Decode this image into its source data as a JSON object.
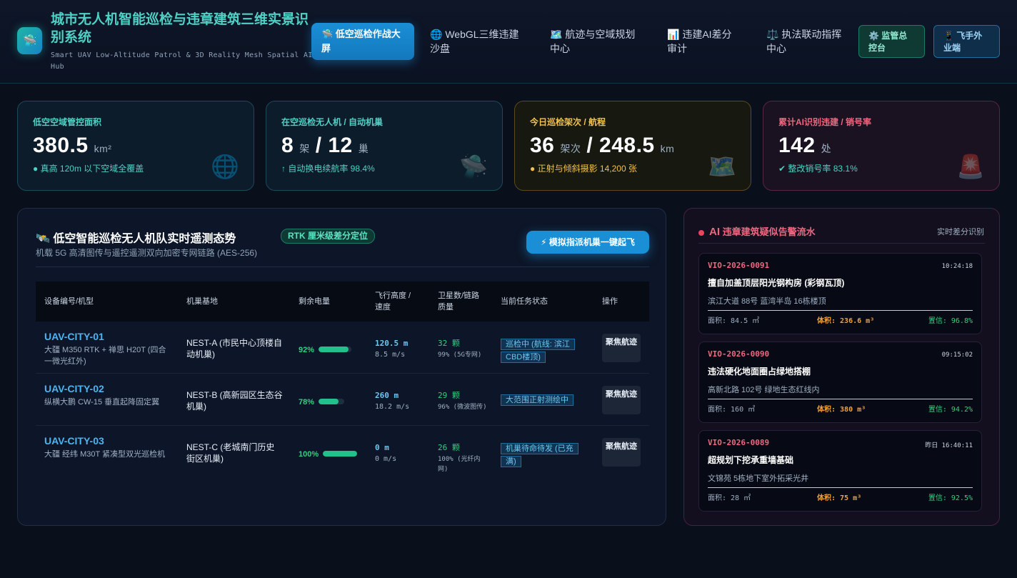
{
  "header": {
    "title": "城市无人机智能巡检与违章建筑三维实景识别系统",
    "subtitle": "Smart UAV Low-Altitude Patrol & 3D Reality Mesh Spatial AI Hub",
    "logo_icon": "ufo-icon",
    "nav": [
      {
        "label": "🛸 低空巡检作战大屏",
        "active": true
      },
      {
        "label": "🌐 WebGL三维违建沙盘",
        "active": false
      },
      {
        "label": "🗺️ 航迹与空域规划中心",
        "active": false
      },
      {
        "label": "📊 违建AI差分审计",
        "active": false
      },
      {
        "label": "⚖️ 执法联动指挥中心",
        "active": false
      }
    ],
    "supervise_label": "⚙️ 监管总控台",
    "mobile_label": "📱 飞手外业端"
  },
  "stats": [
    {
      "label": "低空空域管控面积",
      "value": "380.5",
      "unit": "km²",
      "sub": "● 真高 120m 以下空域全覆盖",
      "icon": "globe-icon"
    },
    {
      "label": "在空巡检无人机 / 自动机巢",
      "value_a": "8",
      "unit_a": "架",
      "value_b": "/ 12",
      "unit_b": "巢",
      "sub": "↑ 自动换电续航率 98.4%",
      "icon": "ufo-icon"
    },
    {
      "label": "今日巡检架次 / 航程",
      "value_a": "36",
      "unit_a": "架次",
      "value_b": "/ 248.5",
      "unit_b": "km",
      "sub": "● 正射与倾斜摄影 14,200 张",
      "icon": "map-icon"
    },
    {
      "label": "累计AI识别违建 / 销号率",
      "value": "142",
      "unit": "处",
      "sub": "✔ 整改销号率 83.1%",
      "icon": "siren-icon"
    }
  ],
  "fleet": {
    "title": "🛰️ 低空智能巡检无人机队实时遥测态势",
    "badge": "RTK 厘米级差分定位",
    "desc": "机载 5G 高清图传与遥控遥测双向加密专网链路 (AES-256)",
    "dispatch_label": "⚡ 模拟指派机巢一键起飞",
    "columns": [
      "设备编号/机型",
      "机巢基地",
      "剩余电量",
      "飞行高度 / 速度",
      "卫星数/链路质量",
      "当前任务状态",
      "操作"
    ],
    "rows": [
      {
        "id": "UAV-CITY-01",
        "model": "大疆 M350 RTK + 禅思 H20T (四合一微光红外)",
        "nest": "NEST-A (市民中心顶楼自动机巢)",
        "battery": "92%",
        "battery_level": 0.92,
        "altitude": "120.5 m",
        "speed": "8.5 m/s",
        "sats": "32 颗",
        "link": "99% (5G专网)",
        "status": "巡检中 (航线: 滨江CBD楼顶)",
        "action": "聚焦航迹"
      },
      {
        "id": "UAV-CITY-02",
        "model": "纵横大鹏 CW-15 垂直起降固定翼",
        "nest": "NEST-B (高新园区生态谷机巢)",
        "battery": "78%",
        "battery_level": 0.78,
        "altitude": "260 m",
        "speed": "18.2 m/s",
        "sats": "29 颗",
        "link": "96% (微波图传)",
        "status": "大范围正射测绘中",
        "action": "聚焦航迹"
      },
      {
        "id": "UAV-CITY-03",
        "model": "大疆 经纬 M30T 紧凑型双光巡检机",
        "nest": "NEST-C (老城南门历史街区机巢)",
        "battery": "100%",
        "battery_level": 1.0,
        "altitude": "0 m",
        "speed": "0 m/s",
        "sats": "26 颗",
        "link": "100% (光纤内网)",
        "status": "机巢待命待发 (已充满)",
        "action": "聚焦航迹"
      }
    ]
  },
  "alerts": {
    "title_ai": "AI",
    "title": "违章建筑疑似告警流水",
    "meta": "实时差分识别",
    "items": [
      {
        "id": "VIO-2026-0091",
        "time": "10:24:18",
        "title": "擅自加盖顶层阳光钢构房 (彩钢瓦顶)",
        "addr": "滨江大道 88号 蓝湾半岛 16栋楼顶",
        "area": "面积: 84.5 ㎡",
        "volume": "体积: 236.6 m³",
        "conf": "置信: 96.8%"
      },
      {
        "id": "VIO-2026-0090",
        "time": "09:15:02",
        "title": "违法硬化地面圈占绿地搭棚",
        "addr": "高新北路 102号 绿地生态红线内",
        "area": "面积: 160 ㎡",
        "volume": "体积: 380 m³",
        "conf": "置信: 94.2%"
      },
      {
        "id": "VIO-2026-0089",
        "time": "昨日 16:40:11",
        "title": "超规划下挖承重墙基础",
        "addr": "文锦苑 5栋地下室外拓采光井",
        "area": "面积: 28 ㎡",
        "volume": "体积: 75 m³",
        "conf": "置信: 92.5%"
      }
    ]
  }
}
